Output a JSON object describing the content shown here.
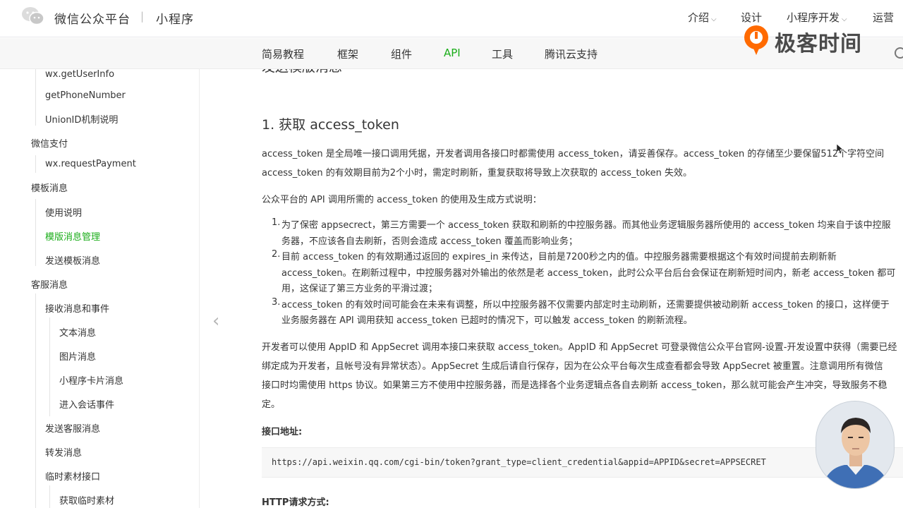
{
  "header": {
    "brand": "微信公众平台",
    "separator": "|",
    "product": "小程序",
    "nav": [
      {
        "label": "介绍",
        "dropdown": true
      },
      {
        "label": "设计",
        "dropdown": false
      },
      {
        "label": "小程序开发",
        "dropdown": true
      },
      {
        "label": "运营",
        "dropdown": false
      }
    ]
  },
  "subnav": {
    "items": [
      "简易教程",
      "框架",
      "组件",
      "API",
      "工具",
      "腾讯云支持"
    ],
    "active": "API"
  },
  "watermark": {
    "text": "极客时间"
  },
  "sidebar": {
    "items": [
      {
        "label": "wx.getUserInfo",
        "level": 2
      },
      {
        "label": "getPhoneNumber",
        "level": 2
      },
      {
        "label": "UnionID机制说明",
        "level": 2
      },
      {
        "label": "微信支付",
        "level": 1
      },
      {
        "label": "wx.requestPayment",
        "level": 2
      },
      {
        "label": "模板消息",
        "level": 1
      },
      {
        "label": "使用说明",
        "level": 2
      },
      {
        "label": "模版消息管理",
        "level": 2,
        "active": true
      },
      {
        "label": "发送模板消息",
        "level": 2
      },
      {
        "label": "客服消息",
        "level": 1
      },
      {
        "label": "接收消息和事件",
        "level": 2
      },
      {
        "label": "文本消息",
        "level": 3
      },
      {
        "label": "图片消息",
        "level": 3
      },
      {
        "label": "小程序卡片消息",
        "level": 3
      },
      {
        "label": "进入会话事件",
        "level": 3
      },
      {
        "label": "发送客服消息",
        "level": 2
      },
      {
        "label": "转发消息",
        "level": 2
      },
      {
        "label": "临时素材接口",
        "level": 2
      },
      {
        "label": "获取临时素材",
        "level": 3
      }
    ]
  },
  "content": {
    "partial_heading": "发送模版消息",
    "heading": "1. 获取 access_token",
    "para1_line1": "access_token 是全局唯一接口调用凭据，开发者调用各接口时都需使用 access_token，请妥善保存。access_token 的存储至少要保留512个字符空间",
    "para1_line2": "access_token 的有效期目前为2个小时，需定时刷新，重复获取将导致上次获取的 access_token 失效。",
    "para2": "公众平台的 API 调用所需的 access_token 的使用及生成方式说明：",
    "list": [
      {
        "num": "1.",
        "lines": [
          "为了保密 appsecrect，第三方需要一个 access_token 获取和刷新的中控服务器。而其他业务逻辑服务器所使用的 access_token 均来自于该中控服",
          "务器，不应该各自去刷新，否则会造成 access_token 覆盖而影响业务；"
        ]
      },
      {
        "num": "2.",
        "lines": [
          "目前 access_token 的有效期通过返回的 expires_in 来传达，目前是7200秒之内的值。中控服务器需要根据这个有效时间提前去刷新新",
          "access_token。在刷新过程中，中控服务器对外输出的依然是老 access_token，此时公众平台后台会保证在刷新短时间内，新老 access_token 都可",
          "用，这保证了第三方业务的平滑过渡；"
        ]
      },
      {
        "num": "3.",
        "lines": [
          "access_token 的有效时间可能会在未来有调整，所以中控服务器不仅需要内部定时主动刷新，还需要提供被动刷新 access_token 的接口，这样便于",
          "业务服务器在 API 调用获知 access_token 已超时的情况下，可以触发 access_token 的刷新流程。"
        ]
      }
    ],
    "para3_lines": [
      "开发者可以使用 AppID 和 AppSecret 调用本接口来获取 access_token。AppID 和 AppSecret 可登录微信公众平台官网-设置-开发设置中获得（需要已经",
      "绑定成为开发者，且帐号没有异常状态）。AppSecret 生成后请自行保存，因为在公众平台每次生成查看都会导致 AppSecret 被重置。注意调用所有微信",
      "接口时均需使用 https 协议。如果第三方不使用中控服务器，而是选择各个业务逻辑点各自去刷新 access_token，那么就可能会产生冲突，导致服务不稳",
      "定。"
    ],
    "endpoint_label": "接口地址:",
    "endpoint_url": "https://api.weixin.qq.com/cgi-bin/token?grant_type=client_credential&appid=APPID&secret=APPSECRET",
    "method_label": "HTTP请求方式:"
  },
  "colors": {
    "accent": "#1aad19",
    "watermark": "#ff6a00",
    "text": "#353535"
  }
}
